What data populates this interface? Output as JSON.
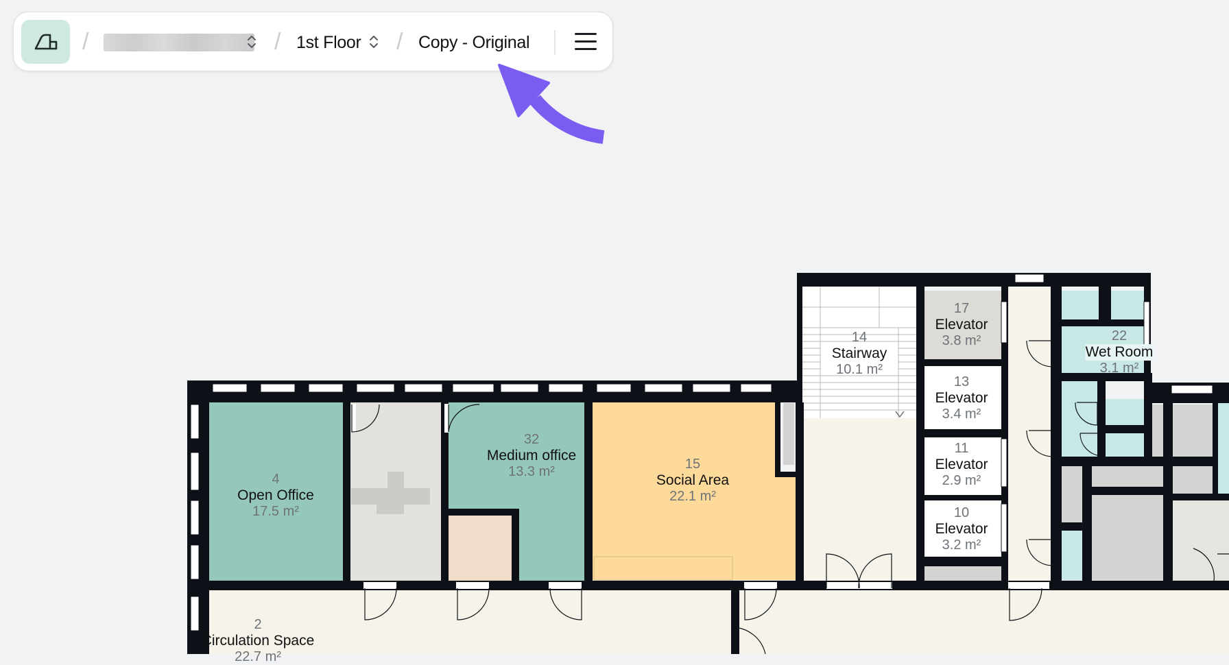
{
  "toolbar": {
    "home_icon": "floorplan-home-icon",
    "separator": "/",
    "project_name": "████████████",
    "floor_label": "1st Floor",
    "version_label": "Copy - Original",
    "menu_icon": "hamburger-menu-icon",
    "chevron_icon": "chevron-up-down-icon"
  },
  "annotation": {
    "arrow_icon": "pointer-arrow-icon",
    "arrow_color": "#7b5cf0"
  },
  "colors": {
    "wall": "#0d1117",
    "open_office": "#95c8bb",
    "social_area": "#fdd99a",
    "circulation": "#f6f4ea",
    "neutral_room": "#e3e1dc",
    "wet_room": "#c8e8e5",
    "gray_room": "#d3d3d3"
  },
  "rooms": [
    {
      "number": "4",
      "name": "Open Office",
      "area": "17.5 m²"
    },
    {
      "number": "32",
      "name": "Medium office",
      "area": "13.3 m²"
    },
    {
      "number": "15",
      "name": "Social Area",
      "area": "22.1 m²"
    },
    {
      "number": "14",
      "name": "Stairway",
      "area": "10.1 m²"
    },
    {
      "number": "17",
      "name": "Elevator",
      "area": "3.8 m²"
    },
    {
      "number": "13",
      "name": "Elevator",
      "area": "3.4 m²"
    },
    {
      "number": "11",
      "name": "Elevator",
      "area": "2.9 m²"
    },
    {
      "number": "10",
      "name": "Elevator",
      "area": "3.2 m²"
    },
    {
      "number": "22",
      "name": "Wet Room",
      "area": "3.1 m²"
    },
    {
      "number": "2",
      "name": "Circulation Space",
      "area": "22.7 m²"
    }
  ]
}
